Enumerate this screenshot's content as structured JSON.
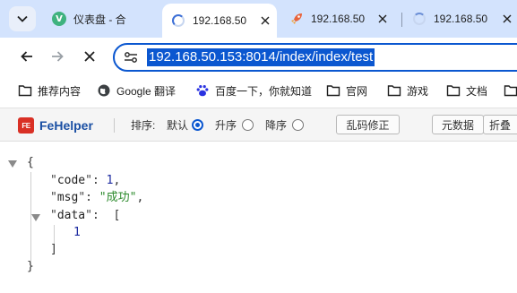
{
  "tabs": [
    {
      "title": "仪表盘 - 合",
      "favicon": "vue-logo-icon",
      "fav_letter": "V",
      "active": false
    },
    {
      "title": "192.168.50",
      "favicon": "loading-spinner-icon",
      "active": true
    },
    {
      "title": "192.168.50",
      "favicon": "rocket-icon",
      "active": false
    },
    {
      "title": "192.168.50",
      "favicon": "loading-spinner-icon",
      "active": false
    }
  ],
  "address_bar": {
    "url": "192.168.50.153:8014/index/index/test",
    "selected": true
  },
  "bookmarks": [
    {
      "label": "推荐内容",
      "icon": "folder-icon"
    },
    {
      "label": "Google 翻译",
      "icon": "globe-icon"
    },
    {
      "label": "百度一下，你就知道",
      "icon": "baidu-paw-icon"
    },
    {
      "label": "官网",
      "icon": "folder-icon"
    },
    {
      "label": "游戏",
      "icon": "folder-icon"
    },
    {
      "label": "文档",
      "icon": "folder-icon"
    }
  ],
  "fehelper": {
    "logo_text": "FE",
    "name": "FeHelper",
    "sort_label": "排序:",
    "sort_options": [
      {
        "label": "默认",
        "checked": true
      },
      {
        "label": "升序",
        "checked": false
      },
      {
        "label": "降序",
        "checked": false
      }
    ],
    "buttons": [
      "乱码修正",
      "元数据",
      "折叠"
    ]
  },
  "json_view": {
    "open_brace": "{",
    "close_brace": "}",
    "code_key": "code",
    "code_value": "1",
    "msg_key": "msg",
    "msg_value": "成功",
    "data_key": "data",
    "data_open": "[",
    "data_item": "1",
    "data_close": "]"
  },
  "colors": {
    "tabstrip_bg": "#d3e3fd",
    "accent": "#0b57d0",
    "fehelper_brand": "#1a4fa3",
    "number": "#1c2aa0",
    "string": "#2c8a2c"
  }
}
